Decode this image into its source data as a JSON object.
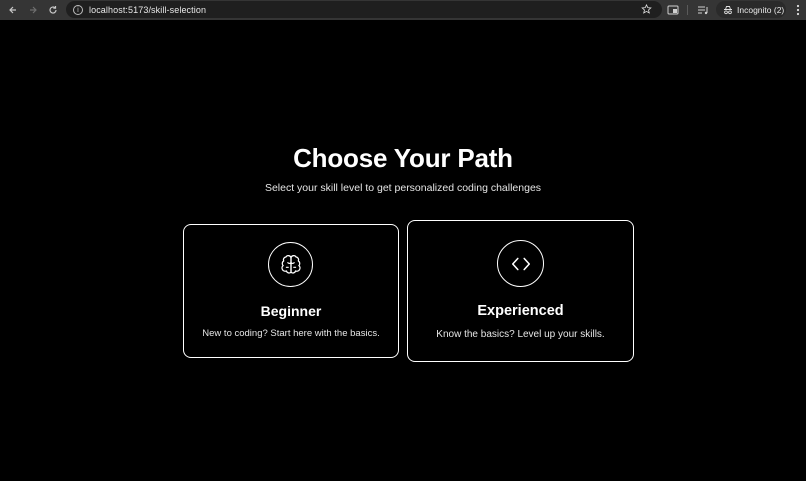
{
  "browser": {
    "url": "localhost:5173/skill-selection",
    "incognito_label": "Incognito (2)",
    "icons": [
      "back-arrow-icon",
      "forward-arrow-icon",
      "reload-icon",
      "site-info-icon",
      "bookmark-star-icon",
      "cast-icon",
      "media-controls-icon",
      "incognito-icon",
      "menu-kebab-icon"
    ]
  },
  "page": {
    "title": "Choose Your Path",
    "subtitle": "Select your skill level to get personalized coding challenges"
  },
  "cards": [
    {
      "title": "Beginner",
      "description": "New to coding? Start here with the basics.",
      "icon": "brain-icon"
    },
    {
      "title": "Experienced",
      "description": "Know the basics? Level up your skills.",
      "icon": "code-brackets-icon"
    }
  ],
  "colors": {
    "background": "#000000",
    "text": "#ffffff",
    "card_border": "#ffffff",
    "chrome": "#353535"
  }
}
